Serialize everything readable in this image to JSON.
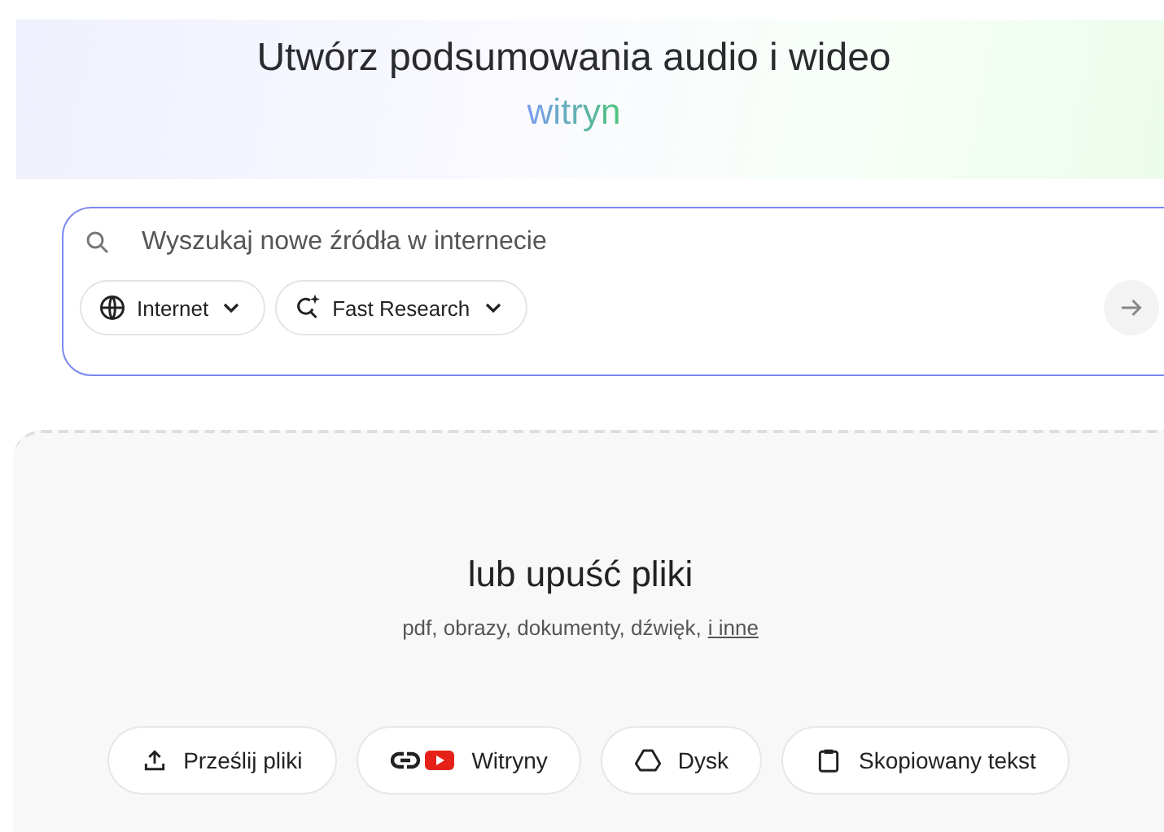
{
  "heading": {
    "title": "Utwórz podsumowania audio i wideo",
    "highlight": "witryn"
  },
  "search": {
    "placeholder": "Wyszukaj nowe źródła w internecie",
    "chips": [
      {
        "kind": "globe",
        "label": "Internet"
      },
      {
        "kind": "research",
        "label": "Fast Research"
      }
    ]
  },
  "dropzone": {
    "title": "lub upuść pliki",
    "hint": "pdf, obrazy, dokumenty, dźwięk,",
    "link": "i inne",
    "buttons": [
      {
        "kind": "upload",
        "label": "Prześlij pliki"
      },
      {
        "kind": "website",
        "label": "Witryny"
      },
      {
        "kind": "drive",
        "label": "Dysk"
      },
      {
        "kind": "clipboard",
        "label": "Skopiowany tekst"
      }
    ]
  }
}
